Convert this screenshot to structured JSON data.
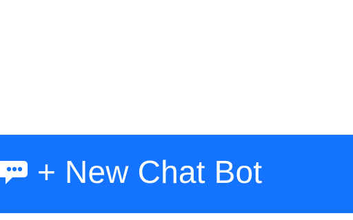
{
  "theme": {
    "accent": "#1473ff",
    "icon_bubble": "#ffffff",
    "icon_dots": "#1473ff"
  },
  "toolbar": {
    "new_chat_bot_label": "+ New Chat Bot",
    "icon": "chat-bubble-icon"
  }
}
